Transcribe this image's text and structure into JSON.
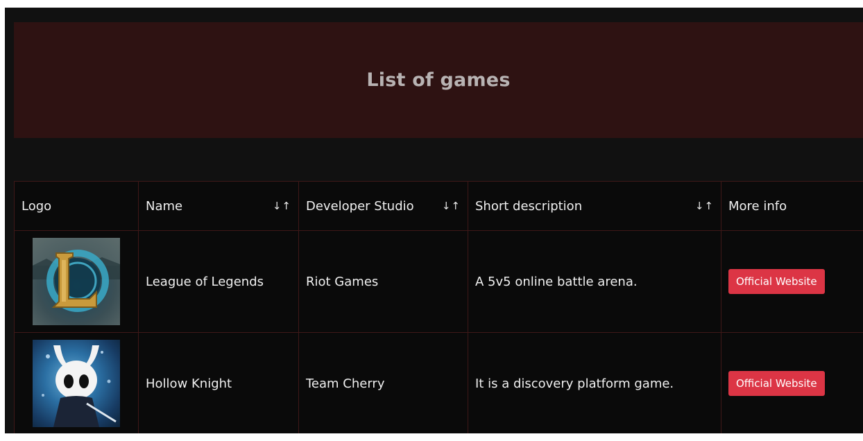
{
  "header": {
    "title": "List of games"
  },
  "table": {
    "columns": [
      {
        "label": "Logo",
        "sortable": false
      },
      {
        "label": "Name",
        "sortable": true
      },
      {
        "label": "Developer Studio",
        "sortable": true
      },
      {
        "label": "Short description",
        "sortable": true
      },
      {
        "label": "More info",
        "sortable": false
      }
    ],
    "sort_icon": "↓↑",
    "rows": [
      {
        "logo_icon": "league-of-legends-logo",
        "name": "League of Legends",
        "developer": "Riot Games",
        "description": "A 5v5 online battle arena.",
        "button_label": "Official Website"
      },
      {
        "logo_icon": "hollow-knight-logo",
        "name": "Hollow Knight",
        "developer": "Team Cherry",
        "description": "It is a discovery platform game.",
        "button_label": "Official Website"
      }
    ]
  },
  "colors": {
    "page_background": "#111111",
    "header_background": "#2e1212",
    "header_text": "#b8b3b3",
    "table_background": "#0a0a0a",
    "table_border": "#3f1818",
    "button": "#dc3545"
  }
}
